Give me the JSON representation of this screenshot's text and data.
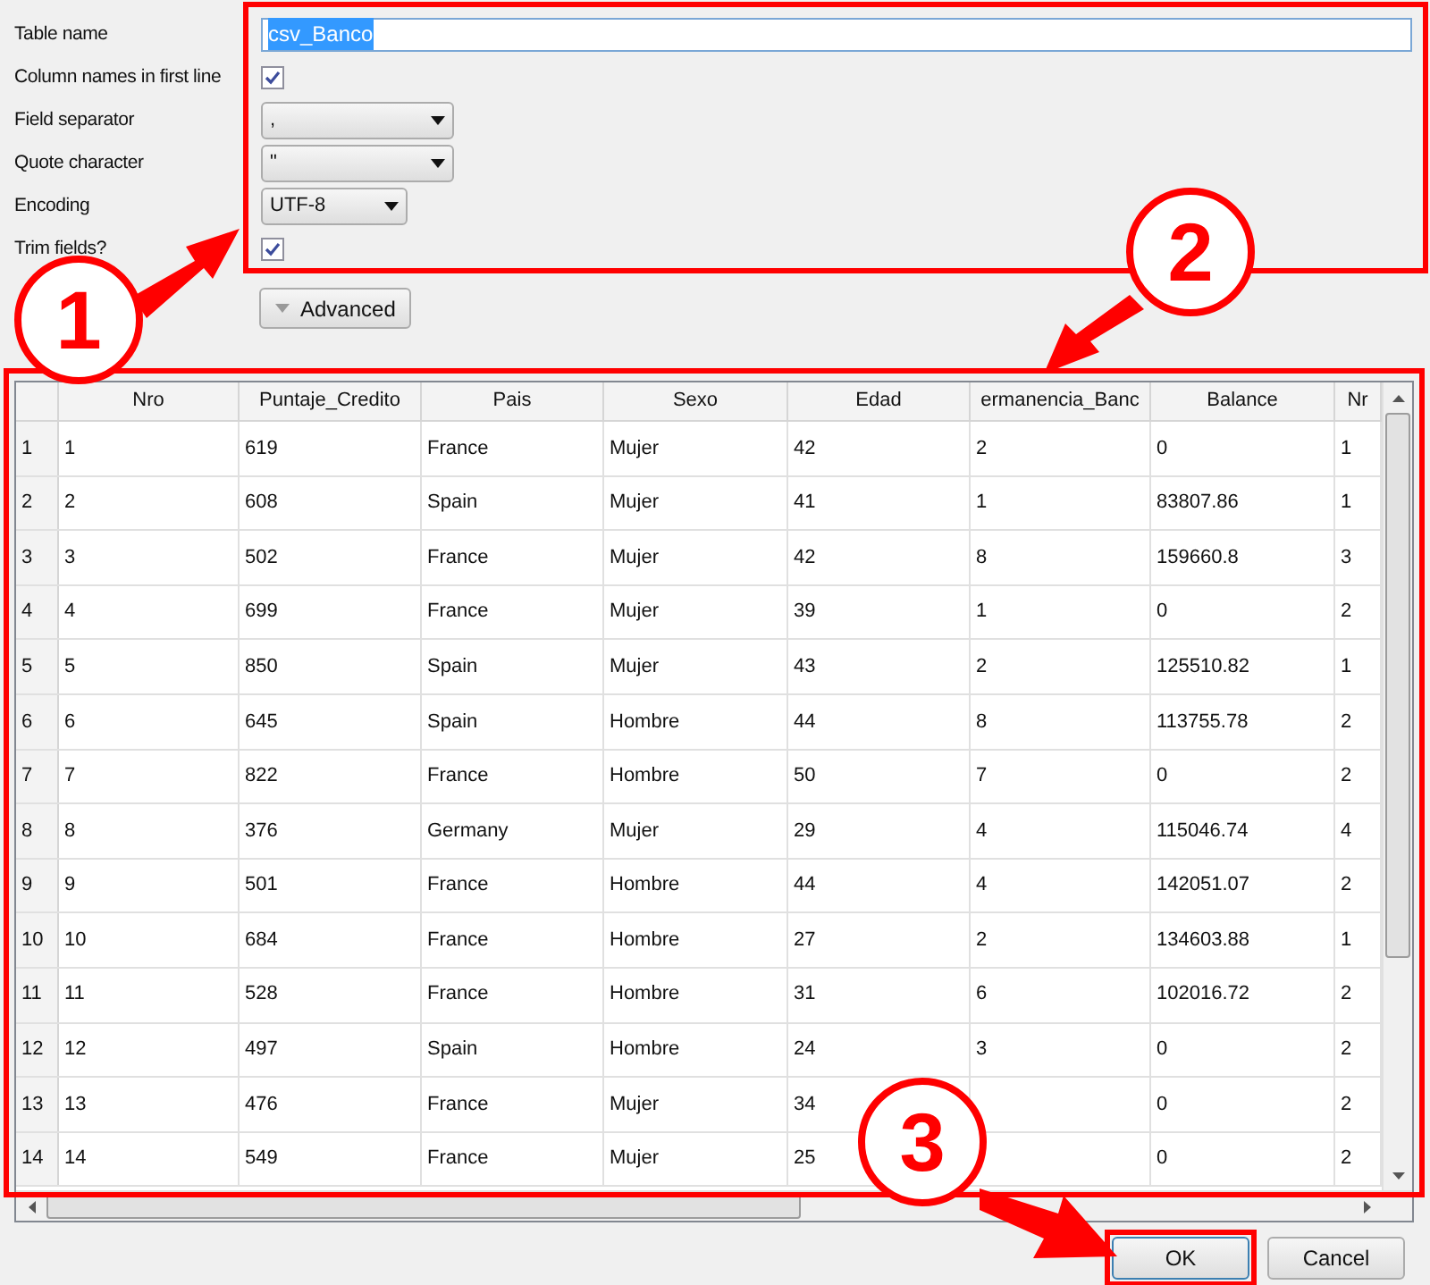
{
  "form": {
    "table_name": {
      "label": "Table name",
      "value": "csv_Banco"
    },
    "column_names": {
      "label": "Column names in first line",
      "checked": true
    },
    "field_separator": {
      "label": "Field separator",
      "value": ","
    },
    "quote_character": {
      "label": "Quote character",
      "value": "\""
    },
    "encoding": {
      "label": "Encoding",
      "value": "UTF-8"
    },
    "trim_fields": {
      "label": "Trim fields?",
      "checked": true
    },
    "advanced": {
      "label": "Advanced",
      "expanded": false
    }
  },
  "table": {
    "columns": [
      "Nro",
      "Puntaje_Credito",
      "Pais",
      "Sexo",
      "Edad",
      "ermanencia_Banc",
      "Balance",
      "Nr"
    ],
    "rows": [
      {
        "header": "1",
        "cells": [
          "1",
          "619",
          "France",
          "Mujer",
          "42",
          "2",
          "0",
          "1"
        ]
      },
      {
        "header": "2",
        "cells": [
          "2",
          "608",
          "Spain",
          "Mujer",
          "41",
          "1",
          "83807.86",
          "1"
        ]
      },
      {
        "header": "3",
        "cells": [
          "3",
          "502",
          "France",
          "Mujer",
          "42",
          "8",
          "159660.8",
          "3"
        ]
      },
      {
        "header": "4",
        "cells": [
          "4",
          "699",
          "France",
          "Mujer",
          "39",
          "1",
          "0",
          "2"
        ]
      },
      {
        "header": "5",
        "cells": [
          "5",
          "850",
          "Spain",
          "Mujer",
          "43",
          "2",
          "125510.82",
          "1"
        ]
      },
      {
        "header": "6",
        "cells": [
          "6",
          "645",
          "Spain",
          "Hombre",
          "44",
          "8",
          "113755.78",
          "2"
        ]
      },
      {
        "header": "7",
        "cells": [
          "7",
          "822",
          "France",
          "Hombre",
          "50",
          "7",
          "0",
          "2"
        ]
      },
      {
        "header": "8",
        "cells": [
          "8",
          "376",
          "Germany",
          "Mujer",
          "29",
          "4",
          "115046.74",
          "4"
        ]
      },
      {
        "header": "9",
        "cells": [
          "9",
          "501",
          "France",
          "Hombre",
          "44",
          "4",
          "142051.07",
          "2"
        ]
      },
      {
        "header": "10",
        "cells": [
          "10",
          "684",
          "France",
          "Hombre",
          "27",
          "2",
          "134603.88",
          "1"
        ]
      },
      {
        "header": "11",
        "cells": [
          "11",
          "528",
          "France",
          "Hombre",
          "31",
          "6",
          "102016.72",
          "2"
        ]
      },
      {
        "header": "12",
        "cells": [
          "12",
          "497",
          "Spain",
          "Hombre",
          "24",
          "3",
          "0",
          "2"
        ]
      },
      {
        "header": "13",
        "cells": [
          "13",
          "476",
          "France",
          "Mujer",
          "34",
          null,
          "0",
          "2"
        ]
      },
      {
        "header": "14",
        "cells": [
          "14",
          "549",
          "France",
          "Mujer",
          "25",
          null,
          "0",
          "2"
        ]
      }
    ]
  },
  "buttons": [
    {
      "label": "OK",
      "selected": true
    },
    {
      "label": "Cancel",
      "selected": false
    }
  ],
  "callouts": [
    "1",
    "2",
    "3"
  ]
}
